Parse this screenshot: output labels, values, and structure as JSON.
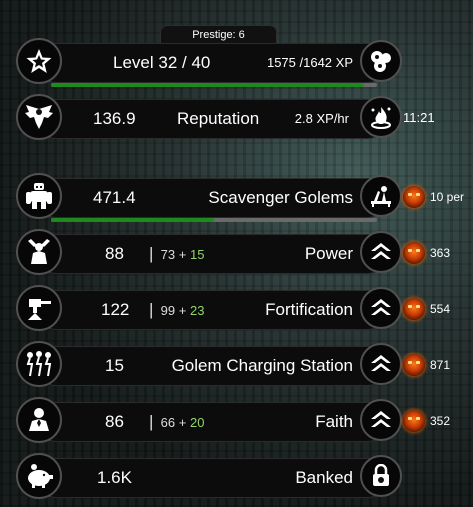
{
  "prestige": "Prestige: 6",
  "level": {
    "label": "Level 32 / 40",
    "xp": "1575 /1642 XP",
    "progress": 0.959
  },
  "reputation": {
    "value": "136.9",
    "label": "Reputation",
    "rate": "2.8 XP/hr",
    "timer": "11:21"
  },
  "golems": {
    "value": "471.4",
    "label": "Scavenger Golems",
    "cost": "10 per",
    "progress": 0.5
  },
  "power": {
    "value": "88",
    "base": "73",
    "plus": "+",
    "bonus": "15",
    "label": "Power",
    "cost": "363"
  },
  "fortification": {
    "value": "122",
    "base": "99",
    "plus": "+",
    "bonus": "23",
    "label": "Fortification",
    "cost": "554"
  },
  "station": {
    "value": "15",
    "label": "Golem Charging Station",
    "cost": "871"
  },
  "faith": {
    "value": "86",
    "base": "66",
    "plus": "+",
    "bonus": "20",
    "label": "Faith",
    "cost": "352"
  },
  "banked": {
    "value": "1.6K",
    "label": "Banked"
  },
  "icons": {
    "level": "star-icon",
    "xp": "orbs-icon",
    "reputation": "eagle-icon",
    "ritual": "flame-icon",
    "golems": "golem-icon",
    "scavenge": "salvage-icon",
    "power": "strength-icon",
    "fortification": "turret-icon",
    "station": "lightning-rods-icon",
    "faith": "prayer-icon",
    "upgrade": "chevron-up-icon",
    "cost": "demon-face-icon",
    "banked": "piggy-bank-icon",
    "lock": "padlock-icon"
  }
}
